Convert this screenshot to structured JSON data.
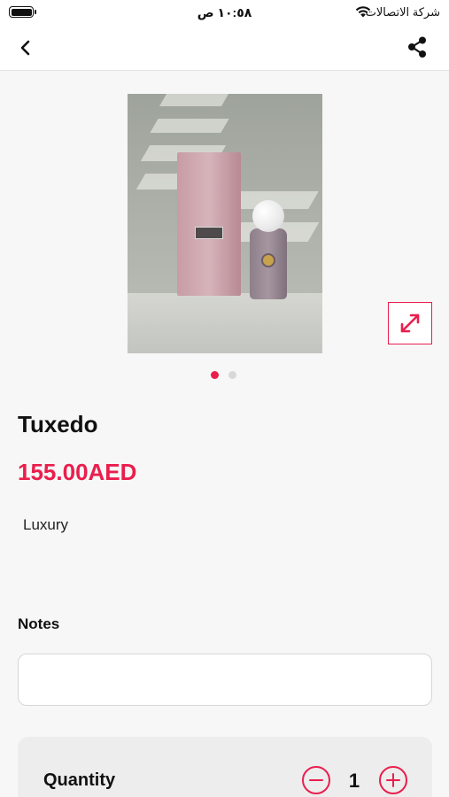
{
  "status_bar": {
    "carrier": "شركة الاتصالات",
    "time": "١٠:٥٨ ص"
  },
  "nav": {
    "back_icon": "chevron-left-icon",
    "share_icon": "share-icon"
  },
  "gallery": {
    "image_count": 2,
    "active_index": 0,
    "expand_icon": "expand-icon",
    "accent_color": "#ea1e4d"
  },
  "product": {
    "name": "Tuxedo",
    "price": "155.00AED",
    "category": "Luxury"
  },
  "notes": {
    "label": "Notes",
    "value": "",
    "placeholder": ""
  },
  "quantity": {
    "label": "Quantity",
    "value": "1",
    "minus_icon": "minus-circle-icon",
    "plus_icon": "plus-circle-icon"
  }
}
